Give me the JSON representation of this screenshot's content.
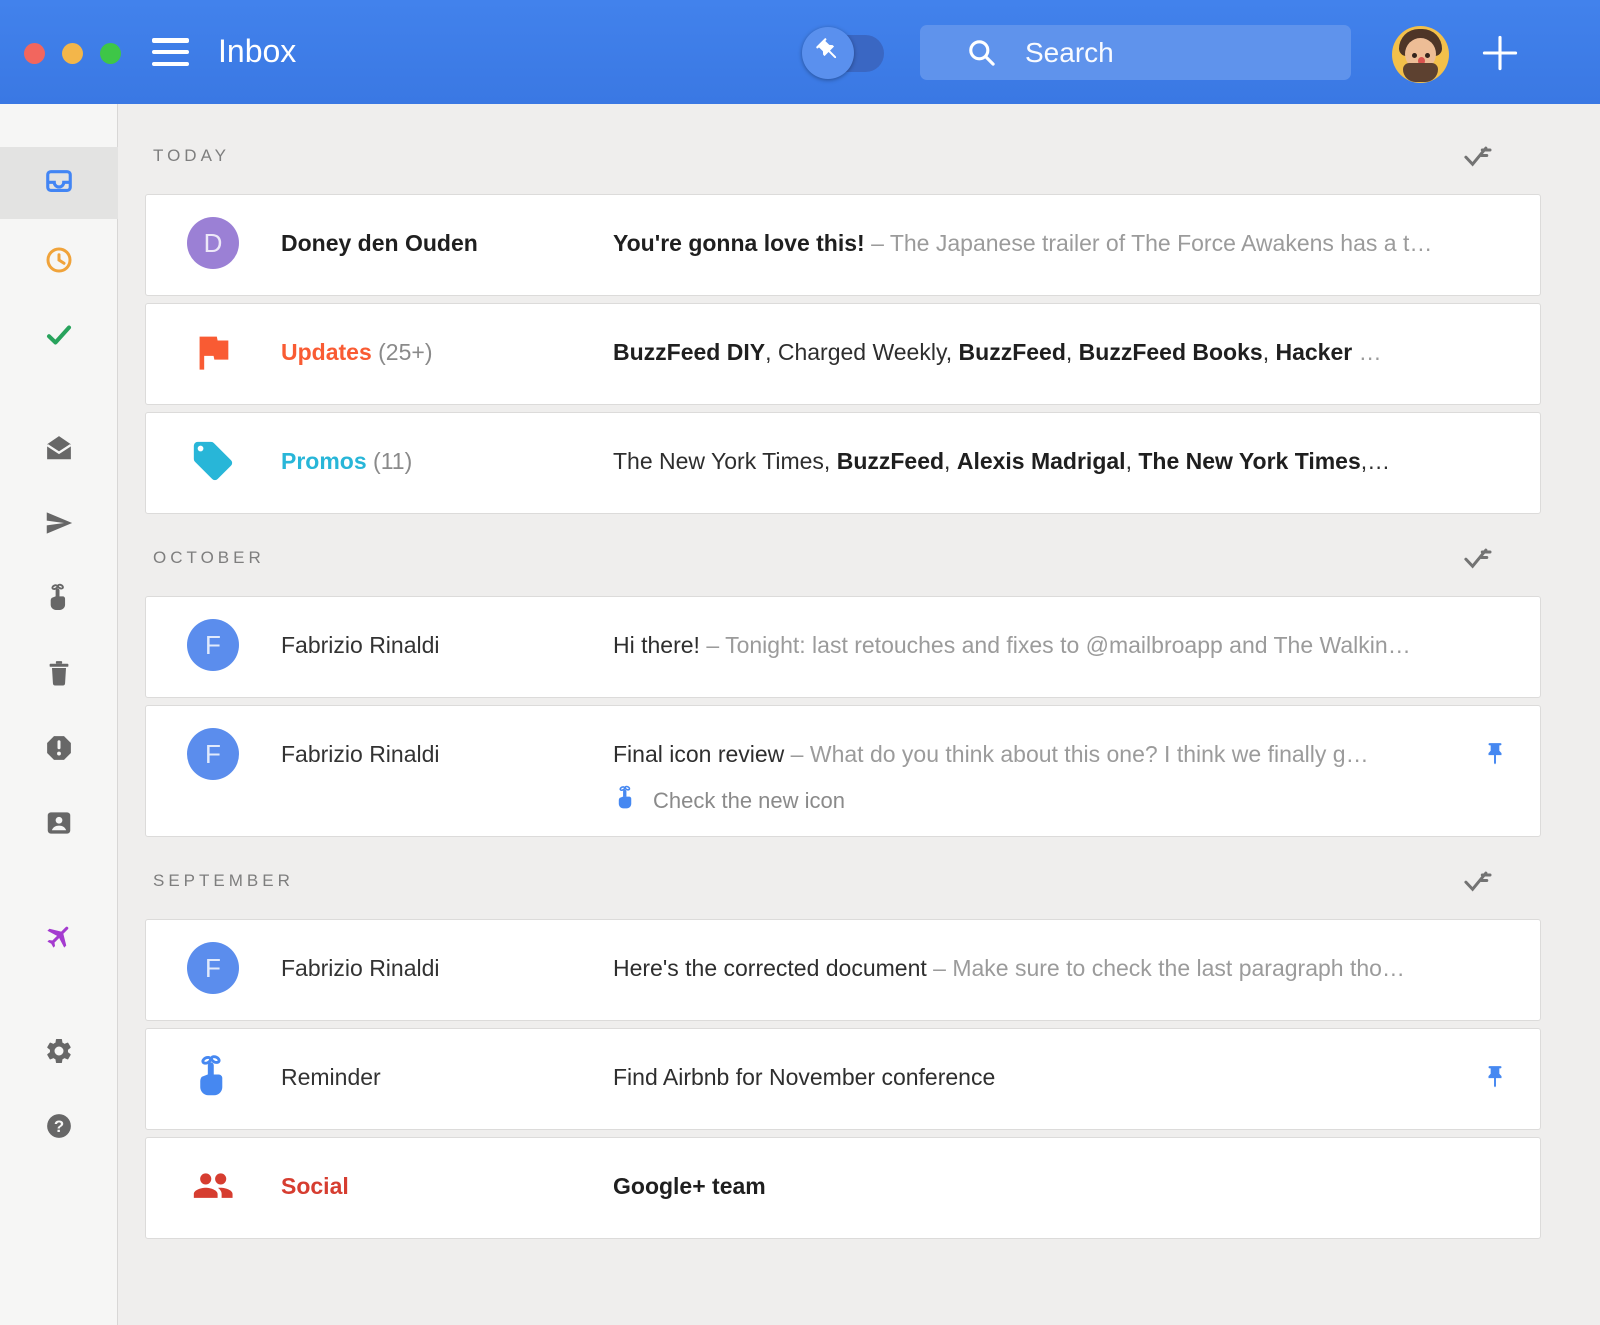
{
  "window": {
    "title": "Inbox",
    "accent_color": "#3d7de8"
  },
  "titlebar": {
    "search_placeholder": "Search",
    "pin_toggle_state": "off"
  },
  "sidebar": {
    "items": [
      {
        "id": "inbox",
        "icon": "inbox-icon",
        "color": "#4285f4",
        "active": true
      },
      {
        "id": "snoozed",
        "icon": "clock-icon",
        "color": "#f0a33a",
        "active": false
      },
      {
        "id": "done",
        "icon": "check-icon",
        "color": "#28a35c",
        "active": false
      },
      {
        "id": "mail",
        "icon": "mail-open-icon",
        "color": "#676767",
        "active": false
      },
      {
        "id": "sent",
        "icon": "send-icon",
        "color": "#676767",
        "active": false
      },
      {
        "id": "reminders",
        "icon": "reminder-hand-icon",
        "color": "#676767",
        "active": false
      },
      {
        "id": "trash",
        "icon": "trash-icon",
        "color": "#676767",
        "active": false
      },
      {
        "id": "spam",
        "icon": "spam-icon",
        "color": "#676767",
        "active": false
      },
      {
        "id": "contacts",
        "icon": "contacts-icon",
        "color": "#676767",
        "active": false
      },
      {
        "id": "trips",
        "icon": "plane-icon",
        "color": "#a43bcf",
        "active": false
      },
      {
        "id": "settings",
        "icon": "gear-icon",
        "color": "#676767",
        "active": false
      },
      {
        "id": "help",
        "icon": "help-icon",
        "color": "#676767",
        "active": false
      }
    ]
  },
  "list": {
    "sections": [
      {
        "label": "TODAY",
        "rows": [
          {
            "avatar": {
              "kind": "letter",
              "letter": "D",
              "color": "#9b80d5"
            },
            "sender": {
              "text": "Doney den Ouden",
              "bold": true
            },
            "subject": [
              {
                "t": "You're gonna love this!",
                "b": true
              },
              {
                "t": " – The Japanese trailer of The Force Awakens has a t…",
                "muted": true
              }
            ]
          },
          {
            "avatar": {
              "kind": "icon",
              "icon": "flag-icon",
              "color": "#f95b33"
            },
            "sender": {
              "text": "Updates",
              "bold": true,
              "color": "#f95b33"
            },
            "count": "(25+)",
            "subject": [
              {
                "t": "BuzzFeed DIY",
                "b": true
              },
              {
                "t": ", Charged Weekly, "
              },
              {
                "t": "BuzzFeed",
                "b": true
              },
              {
                "t": ", "
              },
              {
                "t": "BuzzFeed Books",
                "b": true
              },
              {
                "t": ", "
              },
              {
                "t": "Hacker",
                "b": true
              },
              {
                "t": " …",
                "muted": true
              }
            ]
          },
          {
            "avatar": {
              "kind": "icon",
              "icon": "tag-icon",
              "color": "#28b6d8"
            },
            "sender": {
              "text": "Promos",
              "bold": true,
              "color": "#28b6d8"
            },
            "count": "(11)",
            "subject": [
              {
                "t": "The New York Times, "
              },
              {
                "t": "BuzzFeed",
                "b": true
              },
              {
                "t": ", "
              },
              {
                "t": "Alexis Madrigal",
                "b": true
              },
              {
                "t": ", "
              },
              {
                "t": "The New York Times",
                "b": true
              },
              {
                "t": ",…"
              }
            ]
          }
        ]
      },
      {
        "label": "OCTOBER",
        "rows": [
          {
            "avatar": {
              "kind": "letter",
              "letter": "F",
              "color": "#5b8ded"
            },
            "sender": {
              "text": "Fabrizio Rinaldi"
            },
            "subject": [
              {
                "t": "Hi there!"
              },
              {
                "t": " – Tonight: last retouches and fixes to @mailbroapp and The Walkin…",
                "muted": true
              }
            ]
          },
          {
            "avatar": {
              "kind": "letter",
              "letter": "F",
              "color": "#5b8ded"
            },
            "sender": {
              "text": "Fabrizio Rinaldi"
            },
            "subject": [
              {
                "t": "Final icon review"
              },
              {
                "t": " – What do you think about this one? I think we finally g…",
                "muted": true
              }
            ],
            "pinned": true,
            "chip": {
              "icon": "reminder-hand-icon",
              "label": "Check the new icon"
            }
          }
        ]
      },
      {
        "label": "SEPTEMBER",
        "rows": [
          {
            "avatar": {
              "kind": "letter",
              "letter": "F",
              "color": "#5b8ded"
            },
            "sender": {
              "text": "Fabrizio Rinaldi"
            },
            "subject": [
              {
                "t": "Here's the corrected document"
              },
              {
                "t": " – Make sure to check the last paragraph tho…",
                "muted": true
              }
            ]
          },
          {
            "avatar": {
              "kind": "icon",
              "icon": "reminder-hand-icon",
              "color": "#4688f1"
            },
            "sender": {
              "text": "Reminder"
            },
            "subject": [
              {
                "t": "Find Airbnb for November conference"
              }
            ],
            "pinned": true
          },
          {
            "avatar": {
              "kind": "icon",
              "icon": "people-icon",
              "color": "#d63d30"
            },
            "sender": {
              "text": "Social",
              "bold": true,
              "color": "#d63d30"
            },
            "subject": [
              {
                "t": "Google+ team",
                "b": true
              }
            ]
          }
        ]
      }
    ]
  }
}
